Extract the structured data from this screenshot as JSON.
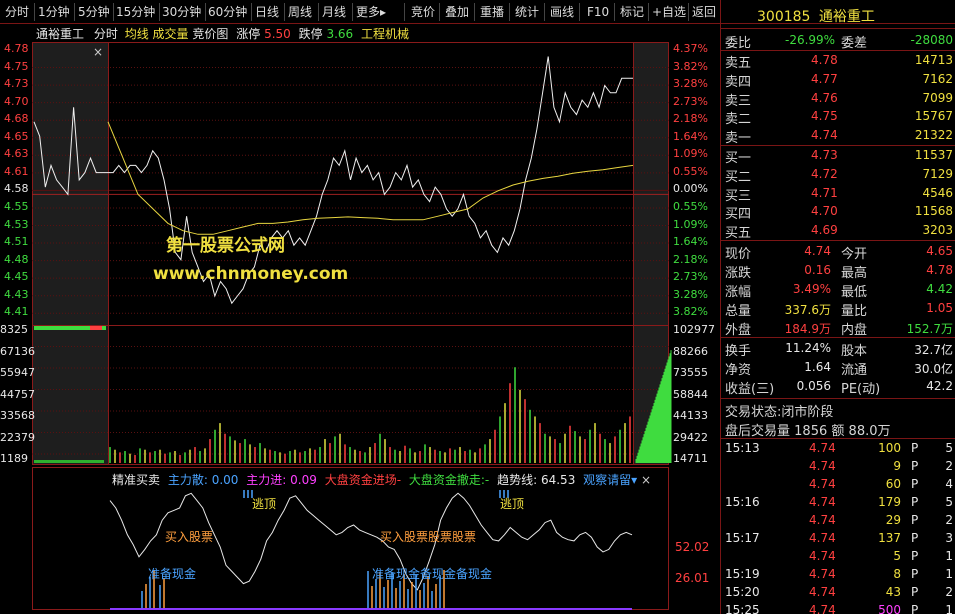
{
  "toolbar": {
    "periods": [
      "分时",
      "1分钟",
      "5分钟",
      "15分钟",
      "30分钟",
      "60分钟",
      "日线",
      "周线",
      "月线",
      "更多"
    ],
    "more_arrow": "▸",
    "tools": [
      "竞价",
      "叠加",
      "重播",
      "统计",
      "画线",
      "F10",
      "标记",
      "+自选",
      "返回"
    ]
  },
  "chart": {
    "stock_name": "通裕重工",
    "mode": "分时",
    "legend": [
      "均线",
      "成交量",
      "竞价图"
    ],
    "limit_up_label": "涨停",
    "limit_up": "5.50",
    "limit_down_label": "跌停",
    "limit_down": "3.66",
    "sector": "工程机械",
    "close_mark": "×",
    "price_ticks": [
      "4.78",
      "4.75",
      "4.73",
      "4.70",
      "4.68",
      "4.65",
      "4.63",
      "4.61",
      "4.58",
      "4.55",
      "4.53",
      "4.51",
      "4.48",
      "4.45",
      "4.43",
      "4.41"
    ],
    "pct_ticks": [
      "4.37%",
      "3.82%",
      "3.28%",
      "2.73%",
      "2.18%",
      "1.64%",
      "1.09%",
      "0.55%",
      "0.00%",
      "0.55%",
      "1.09%",
      "1.64%",
      "2.18%",
      "2.73%",
      "3.28%",
      "3.82%"
    ],
    "vol_left_ticks": [
      "8325",
      "67136",
      "55947",
      "44757",
      "33568",
      "22379",
      "1189"
    ],
    "vol_right_ticks": [
      "102977",
      "88266",
      "73555",
      "58844",
      "44133",
      "29422",
      "14711"
    ],
    "watermark_title": "第一股票公式网",
    "watermark_url": "www.chnmoney.com"
  },
  "chart_data": {
    "type": "line",
    "title": "通裕重工 分时",
    "prev_close": 4.58,
    "ylim": [
      4.4,
      4.79
    ],
    "price_series": [
      4.68,
      4.66,
      4.59,
      4.62,
      4.6,
      4.59,
      4.58,
      4.7,
      4.6,
      4.61,
      4.63,
      4.61,
      4.61,
      4.61,
      4.61,
      4.62,
      4.61,
      4.62,
      4.62,
      4.61,
      4.62,
      4.64,
      4.63,
      4.6,
      4.56,
      4.5,
      4.49,
      4.55,
      4.5,
      4.48,
      4.46,
      4.47,
      4.44,
      4.46,
      4.45,
      4.43,
      4.44,
      4.45,
      4.47,
      4.48,
      4.51,
      4.5,
      4.52,
      4.53,
      4.52,
      4.53,
      4.51,
      4.52,
      4.51,
      4.53,
      4.55,
      4.58,
      4.6,
      4.63,
      4.62,
      4.64,
      4.6,
      4.63,
      4.61,
      4.62,
      4.6,
      4.61,
      4.58,
      4.59,
      4.61,
      4.6,
      4.62,
      4.59,
      4.6,
      4.58,
      4.57,
      4.59,
      4.58,
      4.56,
      4.55,
      4.56,
      4.58,
      4.55,
      4.54,
      4.52,
      4.53,
      4.51,
      4.5,
      4.52,
      4.51,
      4.53,
      4.56,
      4.6,
      4.63,
      4.67,
      4.72,
      4.77,
      4.7,
      4.68,
      4.72,
      4.7,
      4.69,
      4.71,
      4.7,
      4.72,
      4.7,
      4.73,
      4.72,
      4.72,
      4.74,
      4.74,
      4.74
    ],
    "avg_series": [
      4.68,
      4.63,
      4.58,
      4.56,
      4.54,
      4.53,
      4.525,
      4.525,
      4.53,
      4.535,
      4.54,
      4.54,
      4.542,
      4.545,
      4.547,
      4.548,
      4.549,
      4.548,
      4.547,
      4.545,
      4.545,
      4.545,
      4.55,
      4.555,
      4.56,
      4.575,
      4.585,
      4.593,
      4.598,
      4.602,
      4.605,
      4.609,
      4.612,
      4.614,
      4.617,
      4.62
    ],
    "volume_series": [
      12,
      10,
      8,
      9,
      7,
      6,
      11,
      10,
      8,
      9,
      10,
      7,
      8,
      9,
      6,
      8,
      10,
      12,
      9,
      11,
      18,
      25,
      30,
      22,
      20,
      17,
      15,
      18,
      14,
      12,
      15,
      11,
      10,
      9,
      8,
      7,
      9,
      10,
      8,
      9,
      11,
      10,
      12,
      18,
      15,
      20,
      22,
      14,
      12,
      10,
      9,
      8,
      12,
      15,
      22,
      18,
      12,
      10,
      9,
      13,
      11,
      8,
      9,
      14,
      12,
      10,
      9,
      8,
      11,
      10,
      12,
      9,
      10,
      8,
      11,
      14,
      18,
      25,
      35,
      45,
      60,
      72,
      55,
      48,
      40,
      35,
      30,
      22,
      20,
      18,
      15,
      22,
      28,
      24,
      20,
      18,
      25,
      30,
      22,
      18,
      15,
      20,
      25,
      30,
      35
    ],
    "indicator_series": [
      88,
      82,
      72,
      60,
      52,
      42,
      48,
      55,
      60,
      72,
      78,
      80,
      82,
      92,
      94,
      88,
      82,
      70,
      60,
      50,
      35,
      30,
      25,
      20,
      22,
      30,
      40,
      55,
      62,
      72,
      80,
      90,
      92,
      86,
      80,
      76,
      72,
      68,
      64,
      60,
      62,
      66,
      68,
      64,
      62,
      60,
      58,
      55,
      50,
      48,
      40,
      28,
      20,
      15,
      25,
      38,
      52,
      72,
      82,
      90,
      94,
      90,
      84,
      76,
      68,
      62,
      56,
      55,
      60,
      66,
      62,
      58,
      56,
      60,
      64,
      70,
      72,
      62,
      58,
      56,
      55,
      60,
      62,
      58,
      50,
      46,
      48,
      55,
      60,
      62,
      60
    ],
    "vol_ylim": [
      0,
      100
    ],
    "ind_ylim": [
      0,
      100
    ]
  },
  "indicator": {
    "name": "精准买卖",
    "items": [
      {
        "label": "主力散:",
        "value": "0.00",
        "color": "#4aa3ff"
      },
      {
        "label": "主力进:",
        "value": "0.09",
        "color": "#ff40ff"
      },
      {
        "label": "大盘资金进场",
        "value": "-",
        "color": "#ff4040"
      },
      {
        "label": "大盘资金撤走:",
        "value": "-",
        "color": "#3fdc3f"
      },
      {
        "label": "趋势线:",
        "value": "64.53",
        "color": "#e8e8e8"
      }
    ],
    "dropdown": "观察请留▾",
    "close": "×",
    "ticks": [
      "52.02",
      "26.01"
    ],
    "annotations": [
      {
        "text": "逃顶",
        "color": "#f0e040"
      },
      {
        "text": "逃顶",
        "color": "#f0e040"
      },
      {
        "text": "买入股票",
        "color": "#ff9f3f"
      },
      {
        "text": "买入股票股票股票",
        "color": "#ff9f3f"
      },
      {
        "text": "准备现金",
        "color": "#4aa3ff"
      },
      {
        "text": "准备现金备现金备现金",
        "color": "#4aa3ff"
      }
    ]
  },
  "quote": {
    "code": "300185",
    "name": "通裕重工",
    "weibi_label": "委比",
    "weibi": "-26.99%",
    "weicha_label": "委差",
    "weicha": "-28080",
    "asks": [
      {
        "label": "卖五",
        "price": "4.78",
        "vol": "14713"
      },
      {
        "label": "卖四",
        "price": "4.77",
        "vol": "7162"
      },
      {
        "label": "卖三",
        "price": "4.76",
        "vol": "7099"
      },
      {
        "label": "卖二",
        "price": "4.75",
        "vol": "15767"
      },
      {
        "label": "卖一",
        "price": "4.74",
        "vol": "21322"
      }
    ],
    "bids": [
      {
        "label": "买一",
        "price": "4.73",
        "vol": "11537"
      },
      {
        "label": "买二",
        "price": "4.72",
        "vol": "7129"
      },
      {
        "label": "买三",
        "price": "4.71",
        "vol": "4546"
      },
      {
        "label": "买四",
        "price": "4.70",
        "vol": "11568"
      },
      {
        "label": "买五",
        "price": "4.69",
        "vol": "3203"
      }
    ],
    "stats": [
      {
        "l1": "现价",
        "v1": "4.74",
        "c1": "red",
        "l2": "今开",
        "v2": "4.65",
        "c2": "red"
      },
      {
        "l1": "涨跌",
        "v1": "0.16",
        "c1": "red",
        "l2": "最高",
        "v2": "4.78",
        "c2": "red"
      },
      {
        "l1": "涨幅",
        "v1": "3.49%",
        "c1": "red",
        "l2": "最低",
        "v2": "4.42",
        "c2": "green"
      },
      {
        "l1": "总量",
        "v1": "337.6万",
        "c1": "yellow",
        "l2": "量比",
        "v2": "1.05",
        "c2": "red"
      },
      {
        "l1": "外盘",
        "v1": "184.9万",
        "c1": "red",
        "l2": "内盘",
        "v2": "152.7万",
        "c2": "green"
      }
    ],
    "stats2": [
      {
        "l1": "换手",
        "v1": "11.24%",
        "l2": "股本",
        "v2": "32.7亿"
      },
      {
        "l1": "净资",
        "v1": "1.64",
        "l2": "流通",
        "v2": "30.0亿"
      },
      {
        "l1": "收益(三)",
        "v1": "0.056",
        "l2": "PE(动)",
        "v2": "42.2"
      }
    ],
    "trade_state_label": "交易状态:",
    "trade_state": "闭市阶段",
    "after_label": "盘后交易量",
    "after_vol": "1856",
    "after_amt_label": "额",
    "after_amt": "88.0万",
    "ticks": [
      {
        "time": "15:13",
        "price": "4.74",
        "vol": "100",
        "side": "P",
        "n": "5"
      },
      {
        "time": "",
        "price": "4.74",
        "vol": "9",
        "side": "P",
        "n": "2"
      },
      {
        "time": "",
        "price": "4.74",
        "vol": "60",
        "side": "P",
        "n": "4"
      },
      {
        "time": "15:16",
        "price": "4.74",
        "vol": "179",
        "side": "P",
        "n": "5"
      },
      {
        "time": "",
        "price": "4.74",
        "vol": "29",
        "side": "P",
        "n": "2"
      },
      {
        "time": "15:17",
        "price": "4.74",
        "vol": "137",
        "side": "P",
        "n": "3"
      },
      {
        "time": "",
        "price": "4.74",
        "vol": "5",
        "side": "P",
        "n": "1"
      },
      {
        "time": "15:19",
        "price": "4.74",
        "vol": "8",
        "side": "P",
        "n": "1"
      },
      {
        "time": "15:20",
        "price": "4.74",
        "vol": "43",
        "side": "P",
        "n": "2"
      },
      {
        "time": "15:25",
        "price": "4.74",
        "vol": "500",
        "side": "P",
        "n": "1"
      }
    ]
  }
}
